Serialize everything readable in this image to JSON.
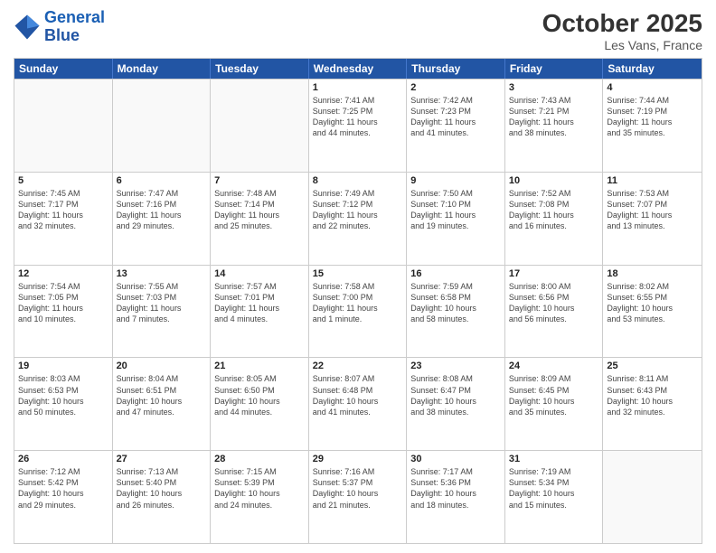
{
  "header": {
    "logo_line1": "General",
    "logo_line2": "Blue",
    "month": "October 2025",
    "location": "Les Vans, France"
  },
  "weekdays": [
    "Sunday",
    "Monday",
    "Tuesday",
    "Wednesday",
    "Thursday",
    "Friday",
    "Saturday"
  ],
  "rows": [
    [
      {
        "day": "",
        "info": ""
      },
      {
        "day": "",
        "info": ""
      },
      {
        "day": "",
        "info": ""
      },
      {
        "day": "1",
        "info": "Sunrise: 7:41 AM\nSunset: 7:25 PM\nDaylight: 11 hours\nand 44 minutes."
      },
      {
        "day": "2",
        "info": "Sunrise: 7:42 AM\nSunset: 7:23 PM\nDaylight: 11 hours\nand 41 minutes."
      },
      {
        "day": "3",
        "info": "Sunrise: 7:43 AM\nSunset: 7:21 PM\nDaylight: 11 hours\nand 38 minutes."
      },
      {
        "day": "4",
        "info": "Sunrise: 7:44 AM\nSunset: 7:19 PM\nDaylight: 11 hours\nand 35 minutes."
      }
    ],
    [
      {
        "day": "5",
        "info": "Sunrise: 7:45 AM\nSunset: 7:17 PM\nDaylight: 11 hours\nand 32 minutes."
      },
      {
        "day": "6",
        "info": "Sunrise: 7:47 AM\nSunset: 7:16 PM\nDaylight: 11 hours\nand 29 minutes."
      },
      {
        "day": "7",
        "info": "Sunrise: 7:48 AM\nSunset: 7:14 PM\nDaylight: 11 hours\nand 25 minutes."
      },
      {
        "day": "8",
        "info": "Sunrise: 7:49 AM\nSunset: 7:12 PM\nDaylight: 11 hours\nand 22 minutes."
      },
      {
        "day": "9",
        "info": "Sunrise: 7:50 AM\nSunset: 7:10 PM\nDaylight: 11 hours\nand 19 minutes."
      },
      {
        "day": "10",
        "info": "Sunrise: 7:52 AM\nSunset: 7:08 PM\nDaylight: 11 hours\nand 16 minutes."
      },
      {
        "day": "11",
        "info": "Sunrise: 7:53 AM\nSunset: 7:07 PM\nDaylight: 11 hours\nand 13 minutes."
      }
    ],
    [
      {
        "day": "12",
        "info": "Sunrise: 7:54 AM\nSunset: 7:05 PM\nDaylight: 11 hours\nand 10 minutes."
      },
      {
        "day": "13",
        "info": "Sunrise: 7:55 AM\nSunset: 7:03 PM\nDaylight: 11 hours\nand 7 minutes."
      },
      {
        "day": "14",
        "info": "Sunrise: 7:57 AM\nSunset: 7:01 PM\nDaylight: 11 hours\nand 4 minutes."
      },
      {
        "day": "15",
        "info": "Sunrise: 7:58 AM\nSunset: 7:00 PM\nDaylight: 11 hours\nand 1 minute."
      },
      {
        "day": "16",
        "info": "Sunrise: 7:59 AM\nSunset: 6:58 PM\nDaylight: 10 hours\nand 58 minutes."
      },
      {
        "day": "17",
        "info": "Sunrise: 8:00 AM\nSunset: 6:56 PM\nDaylight: 10 hours\nand 56 minutes."
      },
      {
        "day": "18",
        "info": "Sunrise: 8:02 AM\nSunset: 6:55 PM\nDaylight: 10 hours\nand 53 minutes."
      }
    ],
    [
      {
        "day": "19",
        "info": "Sunrise: 8:03 AM\nSunset: 6:53 PM\nDaylight: 10 hours\nand 50 minutes."
      },
      {
        "day": "20",
        "info": "Sunrise: 8:04 AM\nSunset: 6:51 PM\nDaylight: 10 hours\nand 47 minutes."
      },
      {
        "day": "21",
        "info": "Sunrise: 8:05 AM\nSunset: 6:50 PM\nDaylight: 10 hours\nand 44 minutes."
      },
      {
        "day": "22",
        "info": "Sunrise: 8:07 AM\nSunset: 6:48 PM\nDaylight: 10 hours\nand 41 minutes."
      },
      {
        "day": "23",
        "info": "Sunrise: 8:08 AM\nSunset: 6:47 PM\nDaylight: 10 hours\nand 38 minutes."
      },
      {
        "day": "24",
        "info": "Sunrise: 8:09 AM\nSunset: 6:45 PM\nDaylight: 10 hours\nand 35 minutes."
      },
      {
        "day": "25",
        "info": "Sunrise: 8:11 AM\nSunset: 6:43 PM\nDaylight: 10 hours\nand 32 minutes."
      }
    ],
    [
      {
        "day": "26",
        "info": "Sunrise: 7:12 AM\nSunset: 5:42 PM\nDaylight: 10 hours\nand 29 minutes."
      },
      {
        "day": "27",
        "info": "Sunrise: 7:13 AM\nSunset: 5:40 PM\nDaylight: 10 hours\nand 26 minutes."
      },
      {
        "day": "28",
        "info": "Sunrise: 7:15 AM\nSunset: 5:39 PM\nDaylight: 10 hours\nand 24 minutes."
      },
      {
        "day": "29",
        "info": "Sunrise: 7:16 AM\nSunset: 5:37 PM\nDaylight: 10 hours\nand 21 minutes."
      },
      {
        "day": "30",
        "info": "Sunrise: 7:17 AM\nSunset: 5:36 PM\nDaylight: 10 hours\nand 18 minutes."
      },
      {
        "day": "31",
        "info": "Sunrise: 7:19 AM\nSunset: 5:34 PM\nDaylight: 10 hours\nand 15 minutes."
      },
      {
        "day": "",
        "info": ""
      }
    ]
  ]
}
